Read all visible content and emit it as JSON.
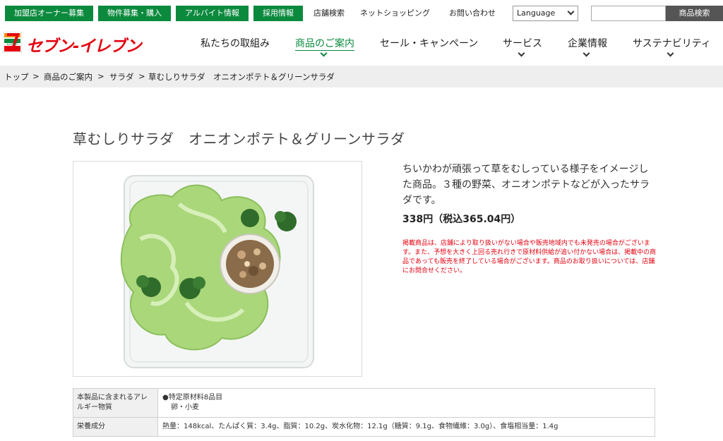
{
  "utility": {
    "buttons": [
      "加盟店オーナー募集",
      "物件募集・購入",
      "アルバイト情報",
      "採用情報"
    ],
    "links": [
      "店舗検索",
      "ネットショッピング",
      "お問い合わせ"
    ],
    "language": "Language",
    "search_button": "商品検索"
  },
  "header": {
    "logo_text": "セブン-イレブン",
    "logo_small": "ELEVEn",
    "nav": [
      "私たちの取組み",
      "商品のご案内",
      "セール・キャンペーン",
      "サービス",
      "企業情報",
      "サステナビリティ"
    ]
  },
  "breadcrumb": [
    "トップ",
    "商品のご案内",
    "サラダ",
    "草むしりサラダ　オニオンポテト＆グリーンサラダ"
  ],
  "product": {
    "title": "草むしりサラダ　オニオンポテト＆グリーンサラダ",
    "description": "ちいかわが頑張って草をむしっている様子をイメージした商品。３種の野菜、オニオンポテトなどが入ったサラダです。",
    "price": "338円（税込365.04円）",
    "notice": "掲載商品は、店舗により取り扱いがない場合や販売地域内でも未発売の場合がございます。また、予想を大きく上回る売れ行きで原材料供給が追い付かない場合は、掲載中の商品であっても販売を終了している場合がございます。商品のお取り扱いについては、店舗にお問合せください。"
  },
  "info": {
    "allergen_label": "本製品に含まれるアレルギー物質",
    "allergen_line1": "●特定原材料8品目",
    "allergen_line2": "卵・小麦",
    "nutrition_label": "栄養成分",
    "nutrition_value": "熱量：148kcal、たんぱく質：3.4g、脂質：10.2g、炭水化物：12.1g（糖質：9.1g、食物繊維：3.0g）、食塩相当量：1.4g"
  },
  "colors": {
    "brand_green": "#0b8a3e",
    "brand_red": "#e3000f",
    "brand_orange": "#f18d00"
  }
}
